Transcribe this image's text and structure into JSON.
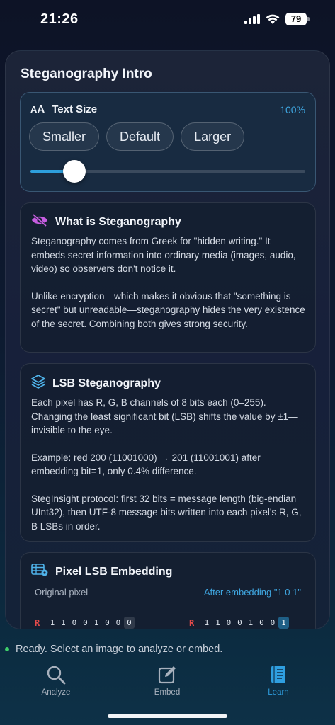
{
  "status": {
    "time": "21:26",
    "battery": "79"
  },
  "sheet": {
    "title": "Steganography Intro"
  },
  "text_size": {
    "label": "Text Size",
    "aa_small": "A",
    "aa_large": "A",
    "percent": "100%",
    "buttons": [
      "Smaller",
      "Default",
      "Larger"
    ],
    "slider_value": 0.16
  },
  "what": {
    "title": "What is Steganography",
    "p1": "Steganography comes from Greek for \"hidden writing.\" It embeds secret information into ordinary media (images, audio, video) so observers don't notice it.",
    "p2": "Unlike encryption—which makes it obvious that \"something is secret\" but unreadable—steganography hides the very existence of the secret. Combining both gives strong security."
  },
  "lsb": {
    "title": "LSB Steganography",
    "p1": "Each pixel has R, G, B channels of 8 bits each (0–255). Changing the least significant bit (LSB) shifts the value by ±1—invisible to the eye.",
    "p2": "Example: red 200 (11001000) → 201 (11001001) after embedding bit=1, only 0.4% difference.",
    "p3": "StegInsight protocol: first 32 bits = message length (big-endian UInt32), then UTF-8 message bits written into each pixel's R, G, B LSBs in order."
  },
  "pixel": {
    "title": "Pixel LSB Embedding",
    "original_label": "Original pixel",
    "after_label": "After embedding \"1 0 1\"",
    "channel": "R",
    "original_bits": [
      "1",
      "1",
      "0",
      "0",
      "1",
      "0",
      "0",
      "0"
    ],
    "after_bits": [
      "1",
      "1",
      "0",
      "0",
      "1",
      "0",
      "0",
      "1"
    ]
  },
  "status_line": "Ready. Select an image to analyze or embed.",
  "tabs": {
    "analyze": "Analyze",
    "embed": "Embed",
    "learn": "Learn"
  },
  "colors": {
    "accent": "#2f9fe0",
    "ready_dot": "#3ed06a",
    "channel_red": "#e34a4a"
  }
}
